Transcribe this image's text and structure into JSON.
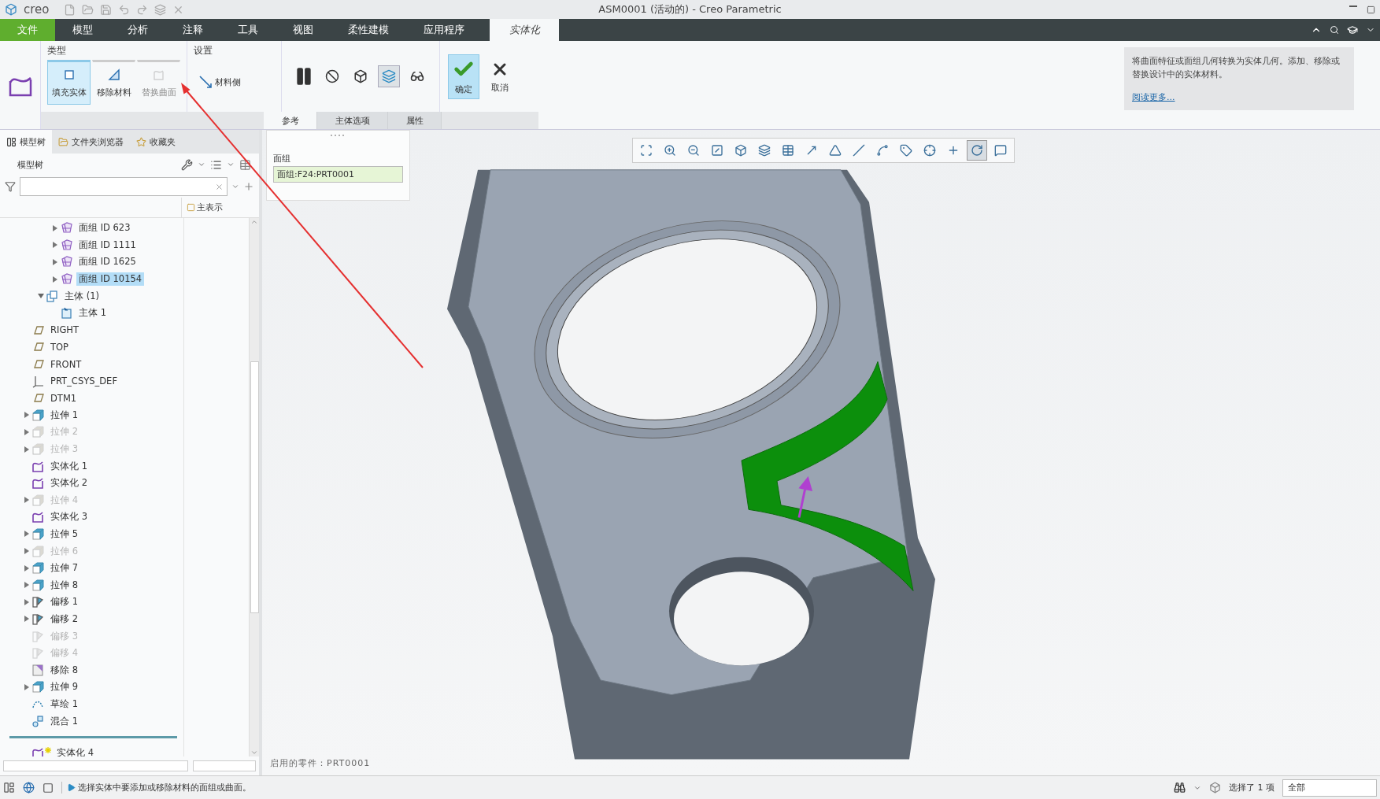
{
  "window": {
    "logo": "creo",
    "title": "ASM0001 (活动的) - Creo Parametric"
  },
  "menu_tabs": [
    {
      "label": "文件",
      "kind": "file",
      "selected": false
    },
    {
      "label": "模型",
      "kind": "tab",
      "selected": false
    },
    {
      "label": "分析",
      "kind": "tab",
      "selected": false
    },
    {
      "label": "注释",
      "kind": "tab",
      "selected": false
    },
    {
      "label": "工具",
      "kind": "tab",
      "selected": false
    },
    {
      "label": "视图",
      "kind": "tab",
      "selected": false
    },
    {
      "label": "柔性建模",
      "kind": "tab",
      "selected": false
    },
    {
      "label": "应用程序",
      "kind": "tab",
      "selected": false
    },
    {
      "label": "实体化",
      "kind": "context",
      "selected": true
    }
  ],
  "ribbon": {
    "type_group": {
      "title": "类型",
      "options": [
        {
          "label": "填充实体",
          "kind": "fill",
          "selected": true,
          "disabled": false
        },
        {
          "label": "移除材料",
          "kind": "remove",
          "selected": false,
          "disabled": false
        },
        {
          "label": "替换曲面",
          "kind": "replace",
          "selected": false,
          "disabled": true
        }
      ]
    },
    "settings_group": {
      "title": "设置",
      "material_side": "材料侧"
    },
    "tools": [
      {
        "kind": "pause",
        "pressed": false
      },
      {
        "kind": "stop",
        "pressed": false
      },
      {
        "kind": "preview_geometry",
        "pressed": false
      },
      {
        "kind": "preview_feature",
        "pressed": true
      },
      {
        "kind": "verify",
        "pressed": false
      }
    ],
    "confirm": "确定",
    "cancel": "取消",
    "sub_tabs": [
      {
        "label": "参考",
        "selected": true
      },
      {
        "label": "主体选项",
        "selected": false
      },
      {
        "label": "属性",
        "selected": false
      }
    ],
    "help": {
      "text": "将曲面特征或面组几何转换为实体几何。添加、移除或替换设计中的实体材料。",
      "link": "阅读更多..."
    }
  },
  "references_panel": {
    "label": "面组",
    "value": "面组:F24:PRT0001"
  },
  "model_tree": {
    "tabs": [
      {
        "label": "模型树",
        "kind": "tree",
        "selected": true
      },
      {
        "label": "文件夹浏览器",
        "kind": "folders",
        "selected": false
      },
      {
        "label": "收藏夹",
        "kind": "favorites",
        "selected": false
      }
    ],
    "heading": "模型树",
    "column_header": "主表示",
    "items": [
      {
        "kind": "hidden_parent",
        "children": [
          {
            "kind": "hidden_parent",
            "children": [
              {
                "label": "面组 ID 623",
                "kind": "quilt",
                "expanded": false,
                "disabled": false,
                "selected": false
              },
              {
                "label": "面组 ID 1111",
                "kind": "quilt",
                "expanded": false,
                "disabled": false,
                "selected": false
              },
              {
                "label": "面组 ID 1625",
                "kind": "quilt",
                "expanded": false,
                "disabled": false,
                "selected": false
              },
              {
                "label": "面组 ID 10154",
                "kind": "quilt",
                "expanded": false,
                "disabled": false,
                "selected": true
              }
            ]
          },
          {
            "label": "主体 (1)",
            "kind": "body_group",
            "expanded": true,
            "disabled": false,
            "selected": false,
            "children": [
              {
                "label": "主体 1",
                "kind": "body",
                "disabled": false,
                "selected": false
              }
            ]
          }
        ]
      },
      {
        "label": "RIGHT",
        "kind": "plane",
        "disabled": false,
        "selected": false
      },
      {
        "label": "TOP",
        "kind": "plane",
        "disabled": false,
        "selected": false
      },
      {
        "label": "FRONT",
        "kind": "plane",
        "disabled": false,
        "selected": false
      },
      {
        "label": "PRT_CSYS_DEF",
        "kind": "csys",
        "disabled": false,
        "selected": false
      },
      {
        "label": "DTM1",
        "kind": "plane",
        "disabled": false,
        "selected": false
      },
      {
        "label": "拉伸 1",
        "kind": "extrude",
        "expanded": false,
        "disabled": false,
        "selected": false
      },
      {
        "label": "拉伸 2",
        "kind": "extrude",
        "expanded": false,
        "disabled": true,
        "selected": false
      },
      {
        "label": "拉伸 3",
        "kind": "extrude",
        "expanded": false,
        "disabled": true,
        "selected": false
      },
      {
        "label": "实体化 1",
        "kind": "solidify",
        "disabled": false,
        "selected": false
      },
      {
        "label": "实体化 2",
        "kind": "solidify",
        "disabled": false,
        "selected": false
      },
      {
        "label": "拉伸 4",
        "kind": "extrude",
        "expanded": false,
        "disabled": true,
        "selected": false
      },
      {
        "label": "实体化 3",
        "kind": "solidify",
        "disabled": false,
        "selected": false
      },
      {
        "label": "拉伸 5",
        "kind": "extrude",
        "expanded": false,
        "disabled": false,
        "selected": false
      },
      {
        "label": "拉伸 6",
        "kind": "extrude",
        "expanded": false,
        "disabled": true,
        "selected": false
      },
      {
        "label": "拉伸 7",
        "kind": "extrude",
        "expanded": false,
        "disabled": false,
        "selected": false
      },
      {
        "label": "拉伸 8",
        "kind": "extrude",
        "expanded": false,
        "disabled": false,
        "selected": false
      },
      {
        "label": "偏移 1",
        "kind": "offset",
        "expanded": false,
        "disabled": false,
        "selected": false
      },
      {
        "label": "偏移 2",
        "kind": "offset",
        "expanded": false,
        "disabled": false,
        "selected": false
      },
      {
        "label": "偏移 3",
        "kind": "offset",
        "disabled": true,
        "selected": false
      },
      {
        "label": "偏移 4",
        "kind": "offset",
        "disabled": true,
        "selected": false
      },
      {
        "label": "移除 8",
        "kind": "remove",
        "disabled": false,
        "selected": false
      },
      {
        "label": "拉伸 9",
        "kind": "extrude",
        "expanded": false,
        "disabled": false,
        "selected": false
      },
      {
        "label": "草绘 1",
        "kind": "sketch",
        "disabled": false,
        "selected": false
      },
      {
        "label": "混合 1",
        "kind": "blend",
        "disabled": false,
        "selected": false
      },
      {
        "kind": "insert_marker"
      },
      {
        "label": "实体化 4",
        "kind": "solidify",
        "new": true,
        "disabled": false,
        "selected": false
      }
    ]
  },
  "view_toolbar": [
    {
      "kind": "zoom_fit",
      "pressed": false
    },
    {
      "kind": "zoom_in",
      "pressed": false
    },
    {
      "kind": "zoom_out",
      "pressed": false
    },
    {
      "kind": "repaint",
      "pressed": false
    },
    {
      "kind": "orientation",
      "pressed": false
    },
    {
      "kind": "saved_views",
      "pressed": false
    },
    {
      "kind": "display_style",
      "pressed": false
    },
    {
      "kind": "view_manager",
      "pressed": false
    },
    {
      "kind": "perspective",
      "pressed": false
    },
    {
      "kind": "planes",
      "pressed": false
    },
    {
      "kind": "axes",
      "pressed": false
    },
    {
      "kind": "plane_tags",
      "pressed": false
    },
    {
      "kind": "points",
      "pressed": false
    },
    {
      "kind": "csys",
      "pressed": false
    },
    {
      "kind": "spin_center",
      "pressed": true
    },
    {
      "kind": "annotations",
      "pressed": false
    }
  ],
  "viewport": {
    "active_part": "启用的零件：PRT0001"
  },
  "status_bar": {
    "message": "选择实体中要添加或移除材料的面组或曲面。",
    "selection": "选择了 1 项",
    "filter": "全部"
  }
}
